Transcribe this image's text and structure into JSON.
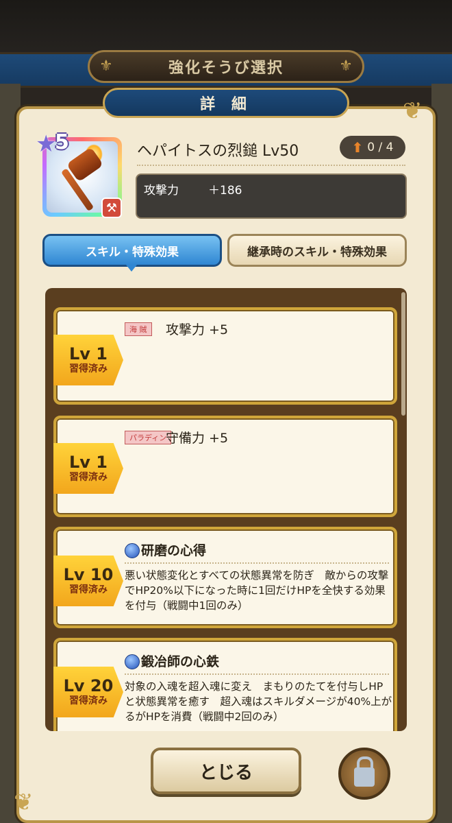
{
  "header": {
    "title": "強化そうび選択"
  },
  "detail_tab": {
    "label": "詳 細"
  },
  "item": {
    "rarity": "5",
    "name": "ヘパイトスの烈鎚 Lv50",
    "upgrade": "0 / 4",
    "stat_label": "攻撃力",
    "stat_value": "＋186"
  },
  "tabs": [
    {
      "label": "スキル・特殊効果",
      "selected": true
    },
    {
      "label": "継承時のスキル・特殊効果",
      "selected": false
    }
  ],
  "skills": [
    {
      "lv": "Lv 1",
      "status": "習得済み",
      "job": "海 賊",
      "effect": "攻撃力 +5"
    },
    {
      "lv": "Lv 1",
      "status": "習得済み",
      "job": "パラディン",
      "effect": "守備力 +5"
    },
    {
      "lv": "Lv 10",
      "status": "習得済み",
      "name": "研磨の心得",
      "desc": "悪い状態変化とすべての状態異常を防ぎ　敵からの攻撃でHP20%以下になった時に1回だけHPを全快する効果を付与（戦闘中1回のみ）"
    },
    {
      "lv": "Lv 20",
      "status": "習得済み",
      "name": "鍛冶師の心鉄",
      "desc": "対象の入魂を超入魂に変え　まもりのたてを付与しHPと状態異常を癒す　超入魂はスキルダメージが40%上がるがHPを消費（戦闘中2回のみ）"
    }
  ],
  "footer": {
    "close_label": "とじる"
  }
}
